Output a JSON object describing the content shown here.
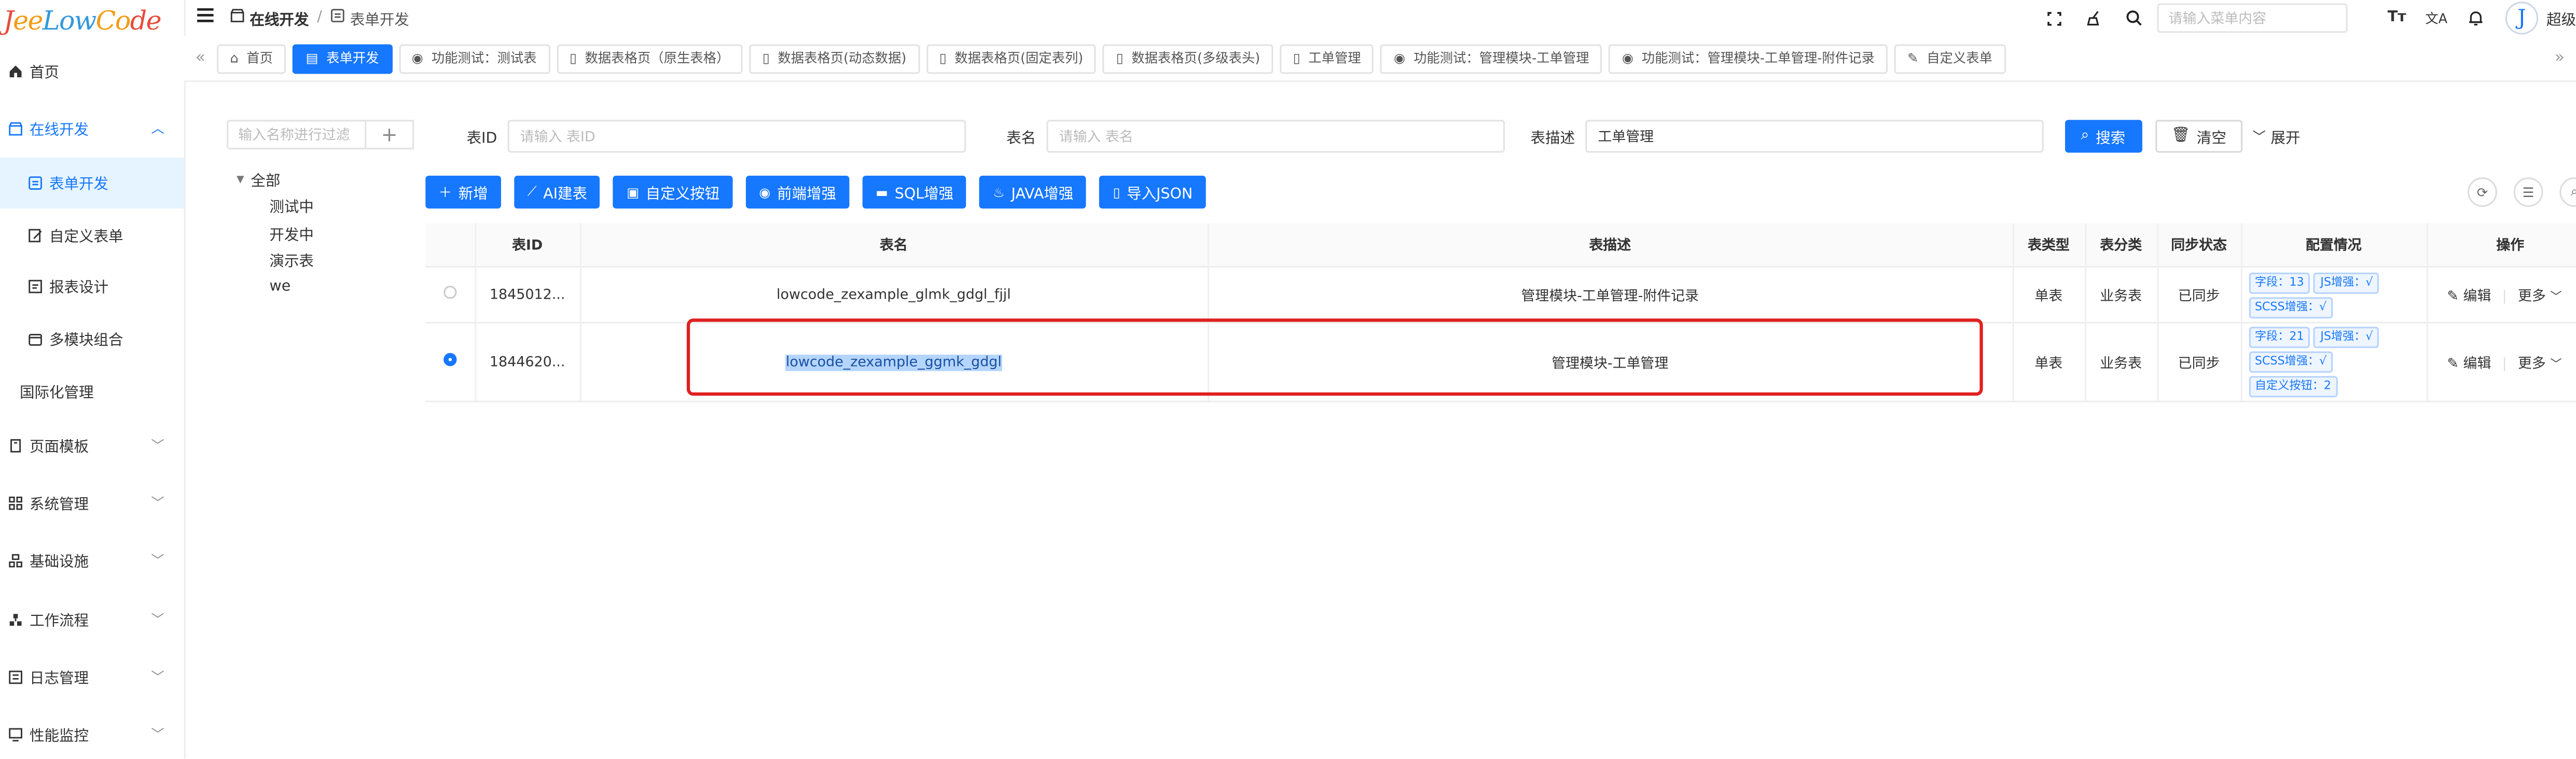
{
  "app": {
    "logo_text": "JeeLowCode",
    "user_name": "超级"
  },
  "sidebar": {
    "items": [
      {
        "label": "首页",
        "icon": "home-icon"
      },
      {
        "label": "在线开发",
        "icon": "shop-icon"
      },
      {
        "label": "表单开发",
        "icon": "form-icon"
      },
      {
        "label": "自定义表单",
        "icon": "edit-icon"
      },
      {
        "label": "报表设计",
        "icon": "report-icon"
      },
      {
        "label": "多模块组合",
        "icon": "module-icon"
      },
      {
        "label": "国际化管理",
        "icon": ""
      },
      {
        "label": "页面模板",
        "icon": "page-icon"
      },
      {
        "label": "系统管理",
        "icon": "grid-icon"
      },
      {
        "label": "基础设施",
        "icon": "infra-icon"
      },
      {
        "label": "工作流程",
        "icon": "flow-icon"
      },
      {
        "label": "日志管理",
        "icon": "log-icon"
      },
      {
        "label": "性能监控",
        "icon": "monitor-icon"
      }
    ]
  },
  "header": {
    "breadcrumb": [
      "在线开发",
      "表单开发"
    ],
    "breadcrumb_sep": "/",
    "search_placeholder": "请输入菜单内容"
  },
  "tabs": [
    {
      "label": "首页",
      "icon": "home-icon"
    },
    {
      "label": "表单开发",
      "icon": "form-icon"
    },
    {
      "label": "功能测试：测试表",
      "icon": "eye-icon"
    },
    {
      "label": "数据表格页（原生表格）",
      "icon": "doc-icon"
    },
    {
      "label": "数据表格页(动态数据)",
      "icon": "doc-icon"
    },
    {
      "label": "数据表格页(固定表列)",
      "icon": "doc-icon"
    },
    {
      "label": "数据表格页(多级表头)",
      "icon": "doc-icon"
    },
    {
      "label": "工单管理",
      "icon": "doc-icon"
    },
    {
      "label": "功能测试：管理模块-工单管理",
      "icon": "eye-icon"
    },
    {
      "label": "功能测试：管理模块-工单管理-附件记录",
      "icon": "eye-icon"
    },
    {
      "label": "自定义表单",
      "icon": "edit-icon"
    }
  ],
  "tree": {
    "search_placeholder": "输入名称进行过滤",
    "add_label": "+",
    "root_label": "全部",
    "children": [
      "测试中",
      "开发中",
      "演示表",
      "we"
    ]
  },
  "filters": {
    "table_id_label": "表ID",
    "table_id_placeholder": "请输入 表ID",
    "table_name_label": "表名",
    "table_name_placeholder": "请输入 表名",
    "table_desc_label": "表描述",
    "table_desc_value": "工单管理",
    "search_label": "搜索",
    "clear_label": "清空",
    "expand_label": "展开"
  },
  "toolbar": {
    "add": "新增",
    "ai": "AI建表",
    "custom_btn": "自定义按钮",
    "frontend": "前端增强",
    "sql": "SQL增强",
    "java": "JAVA增强",
    "import": "导入JSON"
  },
  "table": {
    "headers": [
      "表ID",
      "表名",
      "表描述",
      "表类型",
      "表分类",
      "同步状态",
      "配置情况",
      "操作"
    ],
    "rows": [
      {
        "selected": false,
        "id": "1845012...",
        "name": "lowcode_zexample_glmk_gdgl_fjjl",
        "desc": "管理模块-工单管理-附件记录",
        "type": "单表",
        "category": "业务表",
        "sync": "已同步",
        "tags": [
          "字段：13",
          "JS增强：√",
          "SCSS增强：√"
        ],
        "edit": "编辑",
        "more": "更多"
      },
      {
        "selected": true,
        "id": "1844620...",
        "name": "lowcode_zexample_ggmk_gdgl",
        "desc": "管理模块-工单管理",
        "type": "单表",
        "category": "业务表",
        "sync": "已同步",
        "tags": [
          "字段：21",
          "JS增强：√",
          "SCSS增强：√",
          "自定义按钮：2"
        ],
        "edit": "编辑",
        "more": "更多"
      }
    ]
  },
  "colors": {
    "primary": "#1677ff",
    "success": "#52c41a",
    "highlight_box": "#e02020"
  }
}
